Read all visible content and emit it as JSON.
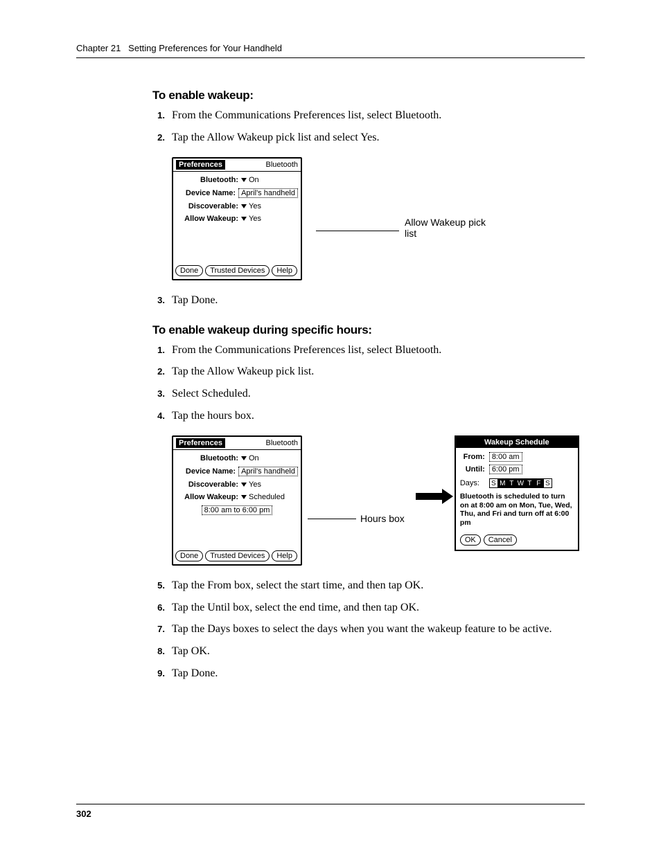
{
  "header": {
    "chapter": "Chapter 21",
    "title": "Setting Preferences for Your Handheld"
  },
  "page_number": "302",
  "section1": {
    "heading": "To enable wakeup:",
    "steps": [
      "From the Communications Preferences list, select Bluetooth.",
      "Tap the Allow Wakeup pick list and select Yes.",
      "Tap Done."
    ]
  },
  "section2": {
    "heading": "To enable wakeup during specific hours:",
    "steps": [
      "From the Communications Preferences list, select Bluetooth.",
      "Tap the Allow Wakeup pick list.",
      "Select Scheduled.",
      "Tap the hours box.",
      "Tap the From box, select the start time, and then tap OK.",
      "Tap the Until box, select the end time, and then tap OK.",
      "Tap the Days boxes to select the days when you want the wakeup feature to be active.",
      "Tap OK.",
      "Tap Done."
    ]
  },
  "palm1": {
    "title_left": "Preferences",
    "title_right": "Bluetooth",
    "rows": {
      "bluetooth_label": "Bluetooth:",
      "bluetooth_value": "On",
      "devicename_label": "Device Name:",
      "devicename_value": "April's handheld",
      "discoverable_label": "Discoverable:",
      "discoverable_value": "Yes",
      "allowwakeup_label": "Allow Wakeup:",
      "allowwakeup_value": "Yes"
    },
    "buttons": {
      "done": "Done",
      "trusted": "Trusted Devices",
      "help": "Help"
    }
  },
  "callout1": "Allow Wakeup pick list",
  "palm2": {
    "title_left": "Preferences",
    "title_right": "Bluetooth",
    "rows": {
      "bluetooth_label": "Bluetooth:",
      "bluetooth_value": "On",
      "devicename_label": "Device Name:",
      "devicename_value": "April's handheld",
      "discoverable_label": "Discoverable:",
      "discoverable_value": "Yes",
      "allowwakeup_label": "Allow Wakeup:",
      "allowwakeup_value": "Scheduled",
      "hours_value": "8:00 am to 6:00 pm"
    },
    "buttons": {
      "done": "Done",
      "trusted": "Trusted Devices",
      "help": "Help"
    }
  },
  "callout2": "Hours box",
  "schedule": {
    "title": "Wakeup Schedule",
    "from_label": "From:",
    "from_value": "8:00 am",
    "until_label": "Until:",
    "until_value": "6:00 pm",
    "days_label": "Days:",
    "days": [
      "S",
      "M",
      "T",
      "W",
      "T",
      "F",
      "S"
    ],
    "days_selected": [
      false,
      true,
      true,
      true,
      true,
      true,
      false
    ],
    "message": "Bluetooth is scheduled to turn on at 8:00 am on Mon, Tue, Wed, Thu, and Fri and turn off at 6:00 pm",
    "buttons": {
      "ok": "OK",
      "cancel": "Cancel"
    }
  }
}
